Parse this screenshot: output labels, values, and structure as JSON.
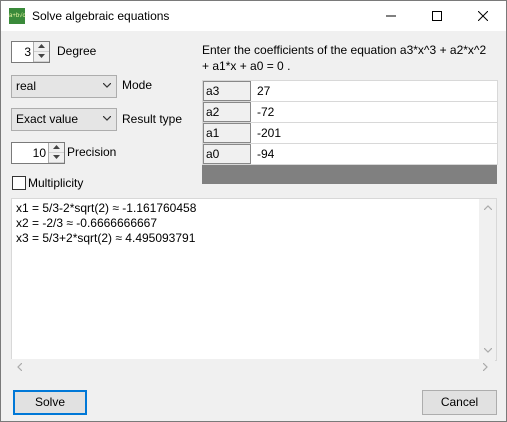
{
  "window": {
    "title": "Solve algebraic equations",
    "icon_text": "a+b√c"
  },
  "controls": {
    "degree": {
      "value": "3",
      "label": "Degree"
    },
    "mode": {
      "value": "real",
      "label": "Mode"
    },
    "result_type": {
      "value": "Exact value",
      "label": "Result type"
    },
    "precision": {
      "value": "10",
      "label": "Precision"
    },
    "multiplicity": {
      "label": "Multiplicity",
      "checked": false
    }
  },
  "equation": {
    "instruction_line1": "Enter the coefficients of the equation  a3*x^3 + a2*x^2",
    "instruction_line2": "+ a1*x + a0 = 0  .",
    "coefficients": [
      {
        "name": "a3",
        "value": "27"
      },
      {
        "name": "a2",
        "value": "-72"
      },
      {
        "name": "a1",
        "value": "-201"
      },
      {
        "name": "a0",
        "value": "-94"
      }
    ]
  },
  "results": [
    "x1 = 5/3-2*sqrt(2) ≈ -1.161760458",
    "x2 = -2/3 ≈ -0.6666666667",
    "x3 = 5/3+2*sqrt(2) ≈ 4.495093791"
  ],
  "buttons": {
    "solve": "Solve",
    "cancel": "Cancel"
  }
}
